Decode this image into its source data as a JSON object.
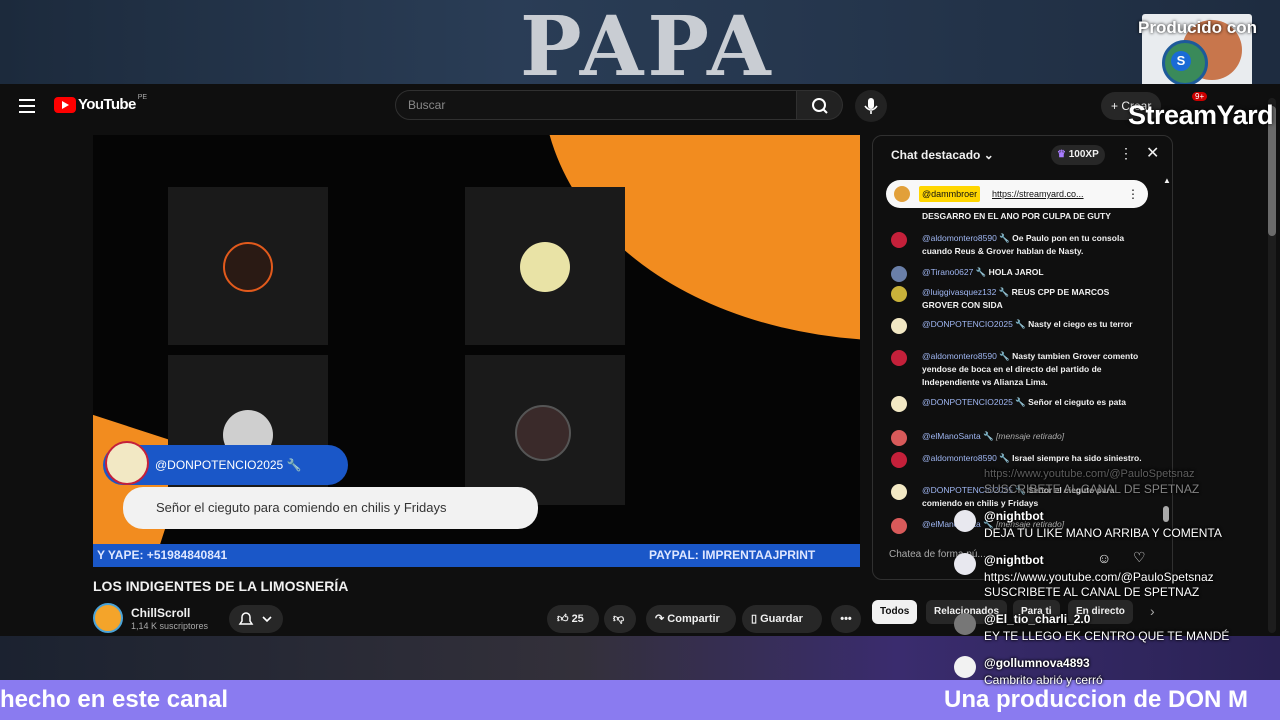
{
  "top_banner": {
    "title": "PAPA",
    "producido": "Producido con",
    "brand": "StreamYard"
  },
  "masthead": {
    "logo": "YouTube",
    "country": "PE",
    "search_placeholder": "Buscar",
    "create_label": "Crear",
    "notifications_badge": "9+"
  },
  "video": {
    "pill_user": "@DONPOTENCIO2025 🔧",
    "pill_message": "Señor el cieguto para comiendo en chilis y Fridays",
    "ticker_left": "Y YAPE: +51984840841",
    "ticker_right": "PAYPAL: IMPRENTAAJPRINT",
    "title": "LOS INDIGENTES DE LA LIMOSNERÍA"
  },
  "channel": {
    "name": "ChillScroll",
    "subs": "1,14 K suscriptores"
  },
  "actions": {
    "likes": "25",
    "share": "Compartir",
    "save": "Guardar"
  },
  "chat": {
    "title": "Chat destacado",
    "xp": "100XP",
    "pinned_user": "@dammbroer",
    "pinned_link": "https://streamyard.co...",
    "input_placeholder": "Chatea de forma pú...",
    "messages": [
      {
        "author": "",
        "text": "DESGARRO EN EL ANO POR CULPA DE GUTY"
      },
      {
        "author": "@aldomontero8590 🔧",
        "text": "Oe Paulo pon en tu consola cuando Reus & Grover hablan de Nasty."
      },
      {
        "author": "@Tirano0627 🔧",
        "text": "HOLA JAROL"
      },
      {
        "author": "@luiggivasquez132 🔧",
        "text": "REUS CPP DE MARCOS GROVER CON SIDA"
      },
      {
        "author": "@DONPOTENCIO2025 🔧",
        "text": "Nasty el ciego es tu terror"
      },
      {
        "author": "@aldomontero8590 🔧",
        "text": "Nasty tambien Grover comento yendose de boca en el directo del partido de Independiente vs Alianza Lima."
      },
      {
        "author": "@DONPOTENCIO2025 🔧",
        "text": "Señor el cieguto es pata"
      },
      {
        "author": "@elManoSanta 🔧",
        "text": "[mensaje retirado]"
      },
      {
        "author": "@aldomontero8590 🔧",
        "text": "Israel siempre ha sido siniestro."
      },
      {
        "author": "@DONPOTENCIO2025 🔧",
        "text": "Señor el cieguto para comiendo en chilis y Fridays"
      },
      {
        "author": "@elManoSanta 🔧",
        "text": "[mensaje retirado]"
      }
    ]
  },
  "chips": [
    "Todos",
    "Relacionados",
    "Para ti",
    "En directo"
  ],
  "overlay": {
    "ghost_1": "https://www.youtube.com/@PauloSpetsnaz",
    "ghost_2": "SUSCRIBETE AL CANAL DE SPETNAZ",
    "items": [
      {
        "name": "@nightbot",
        "text": "DEJA TU LIKE MANO ARRIBA Y COMENTA"
      },
      {
        "name": "@nightbot",
        "text": "https://www.youtube.com/@PauloSpetsnaz",
        "text2": "SUSCRIBETE AL CANAL DE SPETNAZ"
      },
      {
        "name": "@El_tio_charli_2.0",
        "text": "EY TE LLEGO EK CENTRO QUE TE MANDÉ"
      },
      {
        "name": "@gollumnova4893",
        "text": "Cambrito abrió y cerró"
      }
    ]
  },
  "bottom_banner": {
    "left": "hecho en este canal",
    "right": "Una produccion de DON M"
  },
  "colors": {
    "orange": "#f28c1f",
    "blue": "#1a57c8",
    "purple_strip": "#8a7bf0",
    "yt_red": "#ff0000"
  }
}
